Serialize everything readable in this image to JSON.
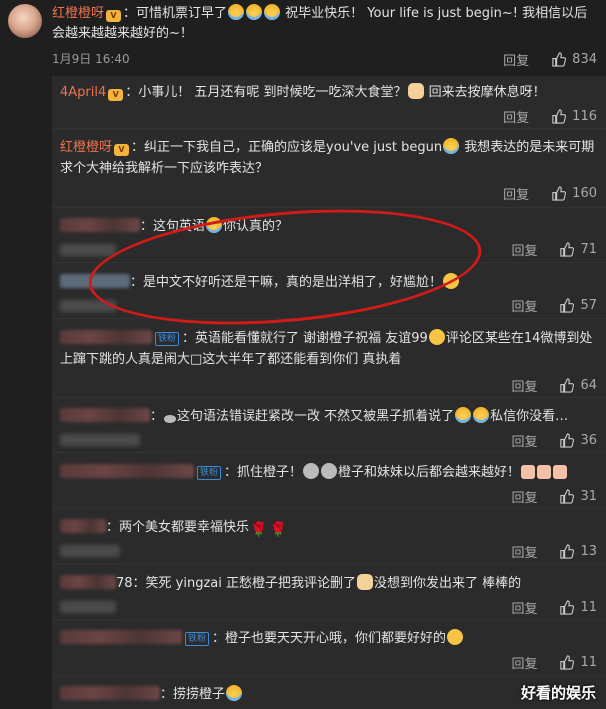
{
  "main": {
    "username": "红橙橙呀",
    "text_1": "：可惜机票订早了",
    "text_2": "祝毕业快乐！ Your life is just begin~! 我相信以后会越来越越来越好的~！",
    "date": "1月9日 16:40",
    "reply_label": "回复",
    "likes": "834"
  },
  "replies": [
    {
      "user": "4April4",
      "pre": "：小事儿！ 五月还有呢 到时候吃一吃深大食堂？",
      "post": " 回来去按摩休息呀！",
      "reply_label": "回复",
      "likes": "116"
    },
    {
      "user": "红橙橙呀",
      "pre": "：纠正一下我自己，正确的应该是you've just begun",
      "post": " 我想表达的是未来可期求个大神给我解析一下应该咋表达？",
      "reply_label": "回复",
      "likes": "160"
    },
    {
      "user": "",
      "pre": "：这句英语",
      "post": "你认真的？",
      "reply_label": "回复",
      "likes": "71"
    },
    {
      "user": "",
      "pre": "：是中文不好听还是干嘛，真的是出洋相了，好尴尬！",
      "post": "",
      "reply_label": "回复",
      "likes": "57"
    },
    {
      "user": "",
      "badge": "铁粉",
      "pre": "：英语能看懂就行了 谢谢橙子祝福 友谊99",
      "post": "评论区某些在14微博到处上蹿下跳的人真是闹大□这大半年了都还能看到你们 真执着",
      "reply_label": "回复",
      "likes": "64"
    },
    {
      "user": "",
      "pre": "：",
      "mid": "这句语法错误赶紧改一改 不然又被黑子抓着说了",
      "post": "私信你没看…",
      "reply_label": "回复",
      "likes": "36"
    },
    {
      "user": "",
      "badge": "铁粉",
      "pre": "：抓住橙子！",
      "post": "橙子和妹妹以后都会越来越好！",
      "reply_label": "回复",
      "likes": "31"
    },
    {
      "user": "",
      "pre": "：两个美女都要幸福快乐",
      "post": "",
      "reply_label": "回复",
      "likes": "13"
    },
    {
      "user": "",
      "pre": "78：笑死 yingzai 正愁橙子把我评论删了",
      "post": "没想到你发出来了 棒棒的",
      "reply_label": "回复",
      "likes": "11"
    },
    {
      "user": "",
      "badge": "铁粉",
      "pre": "：橙子也要天天开心哦，你们都要好好的",
      "post": "",
      "reply_label": "回复",
      "likes": "11"
    },
    {
      "user": "",
      "pre": "：捞捞橙子",
      "post": ""
    }
  ],
  "watermark": "好看的娱乐",
  "colors": {
    "accent": "#eb7350",
    "highlight_ring": "#d11a1a",
    "badge": "#3f8ad6"
  }
}
